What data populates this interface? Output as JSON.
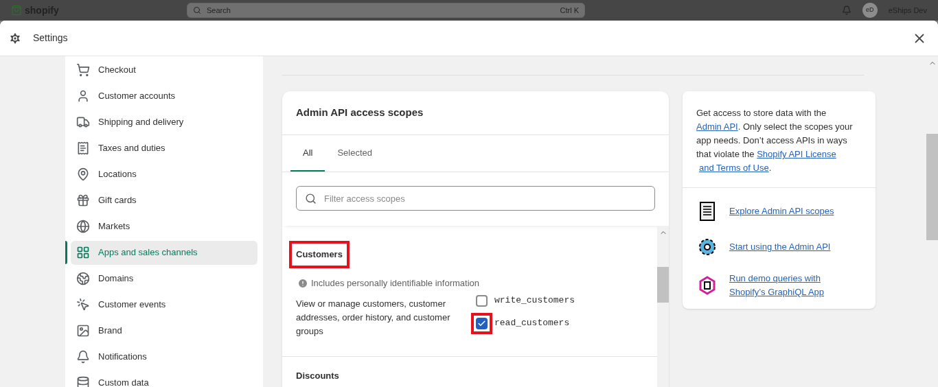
{
  "background": {
    "logo": "shopify",
    "search_placeholder": "Search",
    "search_shortcut": "Ctrl K",
    "avatar_initials": "eD",
    "store_name": "eShips Dev"
  },
  "window": {
    "title": "Settings"
  },
  "sidebar": {
    "items": [
      {
        "label": "Checkout",
        "selected": false
      },
      {
        "label": "Customer accounts",
        "selected": false
      },
      {
        "label": "Shipping and delivery",
        "selected": false
      },
      {
        "label": "Taxes and duties",
        "selected": false
      },
      {
        "label": "Locations",
        "selected": false
      },
      {
        "label": "Gift cards",
        "selected": false
      },
      {
        "label": "Markets",
        "selected": false
      },
      {
        "label": "Apps and sales channels",
        "selected": true
      },
      {
        "label": "Domains",
        "selected": false
      },
      {
        "label": "Customer events",
        "selected": false
      },
      {
        "label": "Brand",
        "selected": false
      },
      {
        "label": "Notifications",
        "selected": false
      },
      {
        "label": "Custom data",
        "selected": false
      }
    ]
  },
  "scopes_card": {
    "title": "Admin API access scopes",
    "tabs": [
      {
        "label": "All",
        "selected": true
      },
      {
        "label": "Selected",
        "selected": false
      }
    ],
    "filter": {
      "placeholder": "Filter access scopes"
    },
    "sections": [
      {
        "title": "Customers",
        "highlighted": true,
        "notice": "Includes personally identifiable information",
        "description": "View or manage customers, customer addresses, order history, and customer groups",
        "scopes": [
          {
            "name": "write_customers",
            "checked": false
          },
          {
            "name": "read_customers",
            "checked": true,
            "highlighted": true
          }
        ]
      },
      {
        "title": "Discounts"
      }
    ]
  },
  "info_card": {
    "paragraph": [
      {
        "kind": "text",
        "text": "Get access to store data with the "
      },
      {
        "kind": "link",
        "text": "Admin API"
      },
      {
        "kind": "text",
        "text": ". Only select the scopes your app needs. Don’t access APIs in ways that violate the "
      },
      {
        "kind": "link",
        "text": "Shopify API License"
      },
      {
        "kind": "link",
        "text": "and Terms of Use"
      },
      {
        "kind": "text",
        "text": "."
      }
    ],
    "resources": [
      {
        "label": "Explore Admin API scopes",
        "kind": "scroll"
      },
      {
        "label": "Start using the Admin API",
        "kind": "gear"
      },
      {
        "label": "Run demo queries with Shopify’s GraphiQL App",
        "kind": "graph"
      }
    ]
  }
}
